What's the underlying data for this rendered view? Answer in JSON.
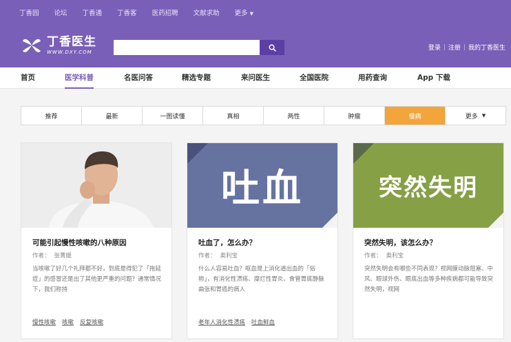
{
  "topnav": {
    "items": [
      "丁香园",
      "论坛",
      "丁香通",
      "丁香客",
      "医药招聘",
      "文献求助",
      "更多"
    ]
  },
  "header": {
    "logo_name": "丁香医生",
    "logo_url": "WWW.DXY.COM",
    "search_placeholder": "",
    "account": [
      "登录",
      "注册",
      "我的丁香医生"
    ],
    "colors": {
      "brand": "#7a5fb8",
      "search_button": "#5b3fa3"
    }
  },
  "mainnav": {
    "items": [
      "首页",
      "医学科普",
      "名医问答",
      "精选专题",
      "来问医生",
      "全国医院",
      "用药查询",
      "App 下载"
    ],
    "active_index": 1
  },
  "cattabs": {
    "items": [
      "推荐",
      "最新",
      "一图读懂",
      "真相",
      "两性",
      "肿瘤",
      "慢病",
      "更多"
    ],
    "active_index": 6,
    "active_color": "#f3a43a"
  },
  "cards": [
    {
      "image": {
        "kind": "photo",
        "subject": "man coughing"
      },
      "title": "可能引起慢性咳嗽的八种原因",
      "author_label": "作者：",
      "author": "张菁媛",
      "desc": "当咳嗽了好几个礼拜都不好，到底是得犯了「拖延症」的感冒还是出了其他更严重的问题？通常情况下，我们称持",
      "tags": [
        "慢性咳嗽",
        "咳嗽",
        "反复咳嗽"
      ]
    },
    {
      "image": {
        "kind": "banner",
        "text": "吐血",
        "bg": "#6673a0"
      },
      "title": "吐血了，怎么办？",
      "author_label": "作者：",
      "author": "奥利宝",
      "desc": "什么人容易吐血？呕血是上消化道出血的「俗称」，有消化性溃疡、糜烂性胃炎、食管胃底静脉曲张和胃癌的病人",
      "tags": [
        "老年人消化性溃疡",
        "吐血鲜血"
      ]
    },
    {
      "image": {
        "kind": "banner",
        "text": "突然失明",
        "bg": "#86a045"
      },
      "title": "突然失明，该怎么办？",
      "author_label": "作者：",
      "author": "奥利宝",
      "desc": "突然失明会有哪些不同表现？视网膜动脉阻塞、中风、眼球外伤、眼底出血等多种疾病都可能导致突然失明，视网",
      "tags": []
    }
  ]
}
